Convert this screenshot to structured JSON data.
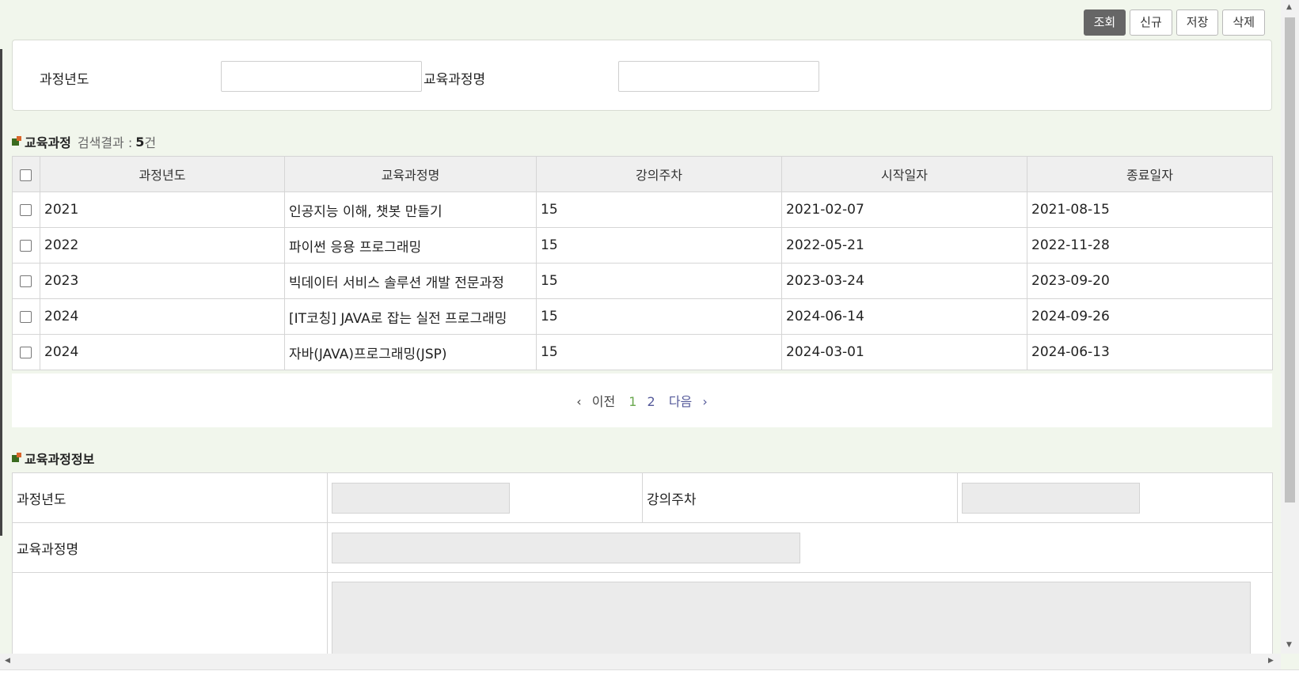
{
  "toolbar": {
    "search_label": "조회",
    "new_label": "신규",
    "save_label": "저장",
    "delete_label": "삭제"
  },
  "search": {
    "year_label": "과정년도",
    "year_value": "",
    "course_name_label": "교육과정명",
    "course_name_value": ""
  },
  "list_section": {
    "title": "교육과정",
    "result_prefix": "검색결과 :",
    "result_count": "5",
    "result_suffix": "건"
  },
  "table": {
    "headers": [
      "과정년도",
      "교육과정명",
      "강의주차",
      "시작일자",
      "종료일자"
    ],
    "rows": [
      {
        "year": "2021",
        "name": "인공지능 이해, 챗봇 만들기",
        "weeks": "15",
        "start": "2021-02-07",
        "end": "2021-08-15"
      },
      {
        "year": "2022",
        "name": "파이썬 응용 프로그래밍",
        "weeks": "15",
        "start": "2022-05-21",
        "end": "2022-11-28"
      },
      {
        "year": "2023",
        "name": "빅데이터 서비스 솔루션 개발 전문과정",
        "weeks": "15",
        "start": "2023-03-24",
        "end": "2023-09-20"
      },
      {
        "year": "2024",
        "name": "[IT코칭] JAVA로 잡는 실전 프로그래밍",
        "weeks": "15",
        "start": "2024-06-14",
        "end": "2024-09-26"
      },
      {
        "year": "2024",
        "name": "자바(JAVA)프로그래밍(JSP)",
        "weeks": "15",
        "start": "2024-03-01",
        "end": "2024-06-13"
      }
    ]
  },
  "pager": {
    "prev": "이전",
    "pages": [
      "1",
      "2"
    ],
    "current": "1",
    "next": "다음"
  },
  "detail_section": {
    "title": "교육과정정보",
    "year_label": "과정년도",
    "weeks_label": "강의주차",
    "name_label": "교육과정명",
    "year_value": "",
    "weeks_value": "",
    "name_value": "",
    "desc_value": ""
  },
  "colors": {
    "page_bg": "#f1f6ec",
    "primary_button": "#666666",
    "current_page": "#6aa84f",
    "page_link": "#555a9a",
    "title_mark_green": "#3a6b1f",
    "title_mark_orange": "#d9662b"
  }
}
